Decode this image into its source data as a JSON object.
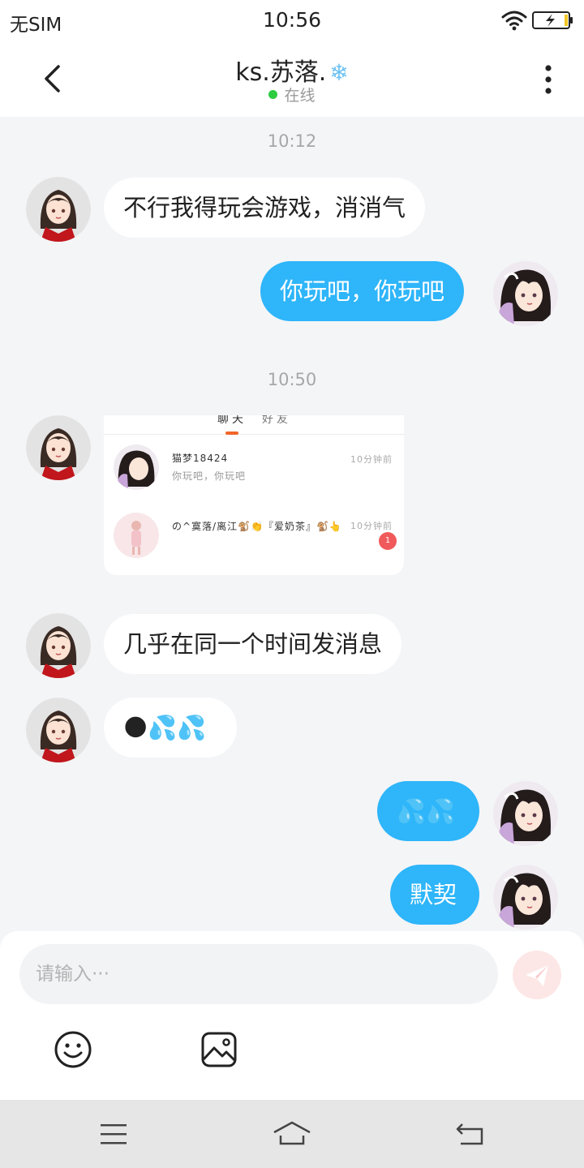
{
  "status_bar": {
    "carrier": "无SIM",
    "time": "10:56"
  },
  "header": {
    "title": "ks.苏落.",
    "title_emoji": "❄",
    "status": "在线"
  },
  "messages": {
    "ts1": "10:12",
    "m1": "不行我得玩会游戏，消消气",
    "m2": "你玩吧，你玩吧",
    "ts2": "10:50",
    "m4": "几乎在同一个时间发消息",
    "m5": "🌑💦💦",
    "m6": "💦💦",
    "m7": "默契"
  },
  "screenshot_card": {
    "tab_chat": "聊天",
    "tab_friends": "好友",
    "row1_name": "猫梦18424",
    "row1_preview": "你玩吧，你玩吧",
    "row1_time": "10分钟前",
    "row2_name": "の^寞落/离江🐒👏『爱奶茶』🐒👆",
    "row2_time": "10分钟前",
    "row2_badge": "1"
  },
  "input": {
    "placeholder": "请输入···"
  },
  "colors": {
    "accent": "#2eb5fa",
    "online": "#2ecc40",
    "send_bg": "#fde6e6",
    "tab_indicator": "#f2642a"
  }
}
